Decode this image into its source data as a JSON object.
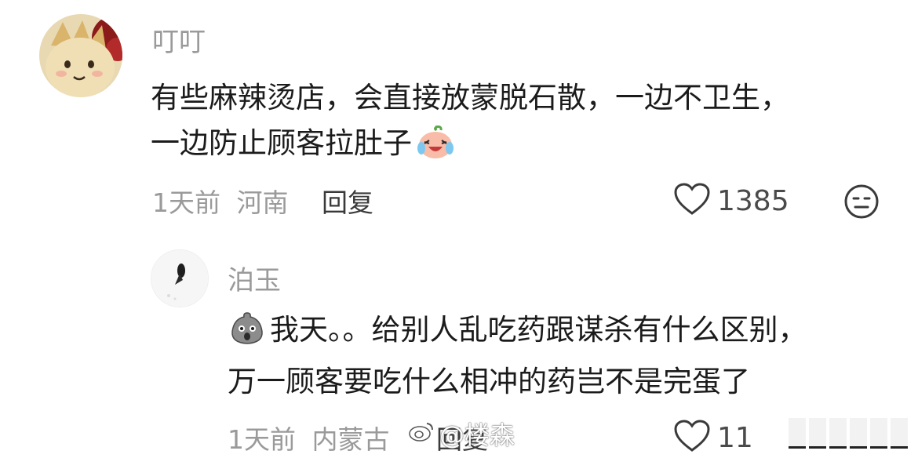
{
  "comments": [
    {
      "author": "叮叮",
      "line1": "有些麻辣烫店，会直接放蒙脱石散，一边不卫生，",
      "line2": "一边防止顾客拉肚子",
      "emoji_icon": "crying-laughing-peach-emoji",
      "time": "1天前",
      "location": "河南",
      "reply_label": "回复",
      "likes": "1385"
    },
    {
      "author": "泊玉",
      "emoji_icon": "shocked-gray-blob-emoji",
      "line1": "我天。。给别人乱吃药跟谋杀有什么区别，",
      "line2": "万一顾客要吃什么相冲的药岂不是完蛋了",
      "time": "1天前",
      "location": "内蒙古",
      "reply_label": "回复",
      "likes": "11"
    }
  ],
  "watermark": {
    "text": "@楼森"
  }
}
